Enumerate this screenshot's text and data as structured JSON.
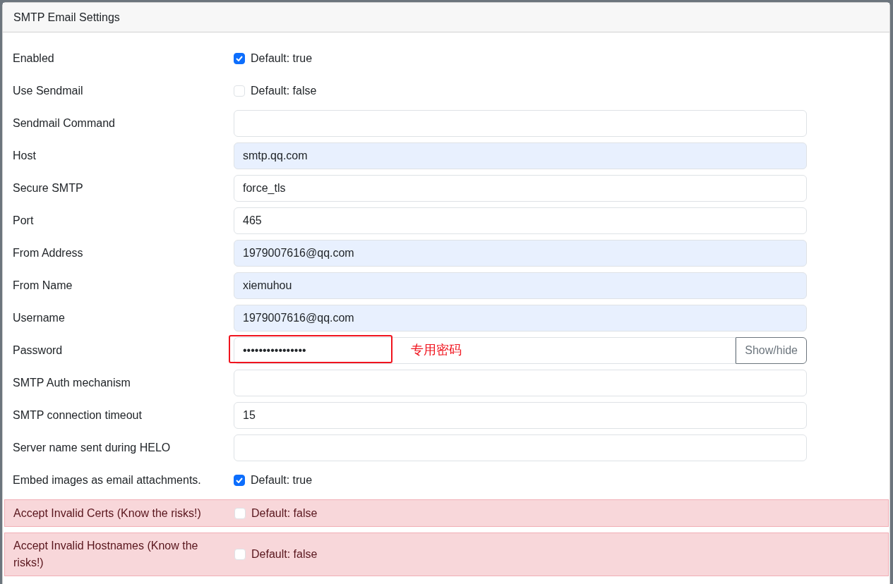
{
  "card": {
    "title": "SMTP Email Settings"
  },
  "fields": [
    {
      "kind": "checkbox",
      "label": "Enabled",
      "checked": true,
      "note": "Default: true",
      "warning": false
    },
    {
      "kind": "checkbox",
      "label": "Use Sendmail",
      "checked": false,
      "note": "Default: false",
      "warning": false
    },
    {
      "kind": "text",
      "label": "Sendmail Command",
      "autofilled": false
    },
    {
      "kind": "text",
      "label": "Host",
      "value": "smtp.qq.com",
      "autofilled": true
    },
    {
      "kind": "text",
      "label": "Secure SMTP",
      "value": "force_tls",
      "autofilled": false
    },
    {
      "kind": "text",
      "label": "Port",
      "value": "465",
      "autofilled": false
    },
    {
      "kind": "text",
      "label": "From Address",
      "value": "1979007616@qq.com",
      "autofilled": true
    },
    {
      "kind": "text",
      "label": "From Name",
      "value": "xiemuhou",
      "autofilled": true
    },
    {
      "kind": "text",
      "label": "Username",
      "value": "1979007616@qq.com",
      "autofilled": true
    },
    {
      "kind": "password",
      "label": "Password",
      "value": "••••••••••••••••",
      "button": "Show/hide",
      "annotation": "专用密码"
    },
    {
      "kind": "text",
      "label": "SMTP Auth mechanism",
      "autofilled": false
    },
    {
      "kind": "text",
      "label": "SMTP connection timeout",
      "value": "15",
      "autofilled": false
    },
    {
      "kind": "text",
      "label": "Server name sent during HELO",
      "autofilled": false
    },
    {
      "kind": "checkbox",
      "label": "Embed images as email attachments.",
      "checked": true,
      "note": "Default: true",
      "warning": false
    },
    {
      "kind": "checkbox",
      "label": "Accept Invalid Certs (Know the risks!)",
      "checked": false,
      "note": "Default: false",
      "warning": true
    },
    {
      "kind": "checkbox",
      "label": "Accept Invalid Hostnames (Know the risks!)",
      "checked": false,
      "note": "Default: false",
      "warning": true
    }
  ]
}
